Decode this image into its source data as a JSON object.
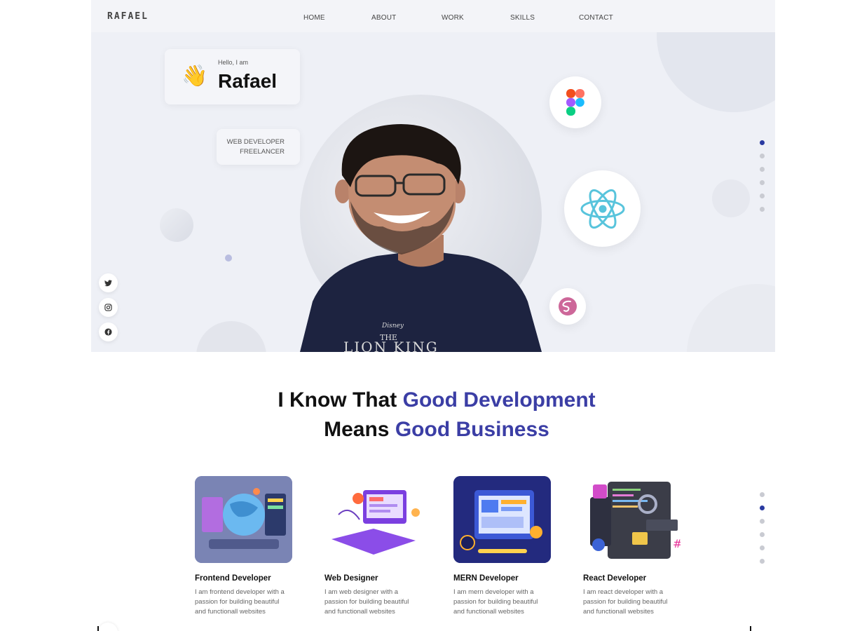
{
  "nav": {
    "logo": "RAFAEL",
    "links": [
      "HOME",
      "ABOUT",
      "WORK",
      "SKILLS",
      "CONTACT"
    ]
  },
  "hero": {
    "greeting": "Hello, I am",
    "name": "Rafael",
    "roles": [
      "WEB DEVELOPER",
      "FREELANCER"
    ],
    "shirt_text": [
      "Disney",
      "THE",
      "LION KING"
    ]
  },
  "social": [
    "twitter-icon",
    "instagram-icon",
    "facebook-icon"
  ],
  "tech_icons": [
    "figma-icon",
    "react-icon",
    "sass-icon"
  ],
  "pager_top": {
    "count": 6,
    "active": 0
  },
  "pager_bottom": {
    "count": 6,
    "active": 1
  },
  "headline": {
    "line1_plain": "I Know That ",
    "line1_accent": "Good Development",
    "line2_plain": "Means ",
    "line2_accent": "Good Business"
  },
  "services": [
    {
      "title": "Frontend Developer",
      "desc": "I am frontend developer with a passion for building beautiful and functionall websites"
    },
    {
      "title": "Web Designer",
      "desc": "I am web designer with a passion for building beautiful and functionall websites"
    },
    {
      "title": "MERN Developer",
      "desc": "I am mern developer with a passion for building beautiful and functionall websites"
    },
    {
      "title": "React Developer",
      "desc": "I am react developer with a passion for building beautiful and functionall websites"
    }
  ],
  "colors": {
    "accent": "#3b3ea5",
    "hero_bg": "#eef0f6",
    "active_dot": "#2a3aa1"
  }
}
